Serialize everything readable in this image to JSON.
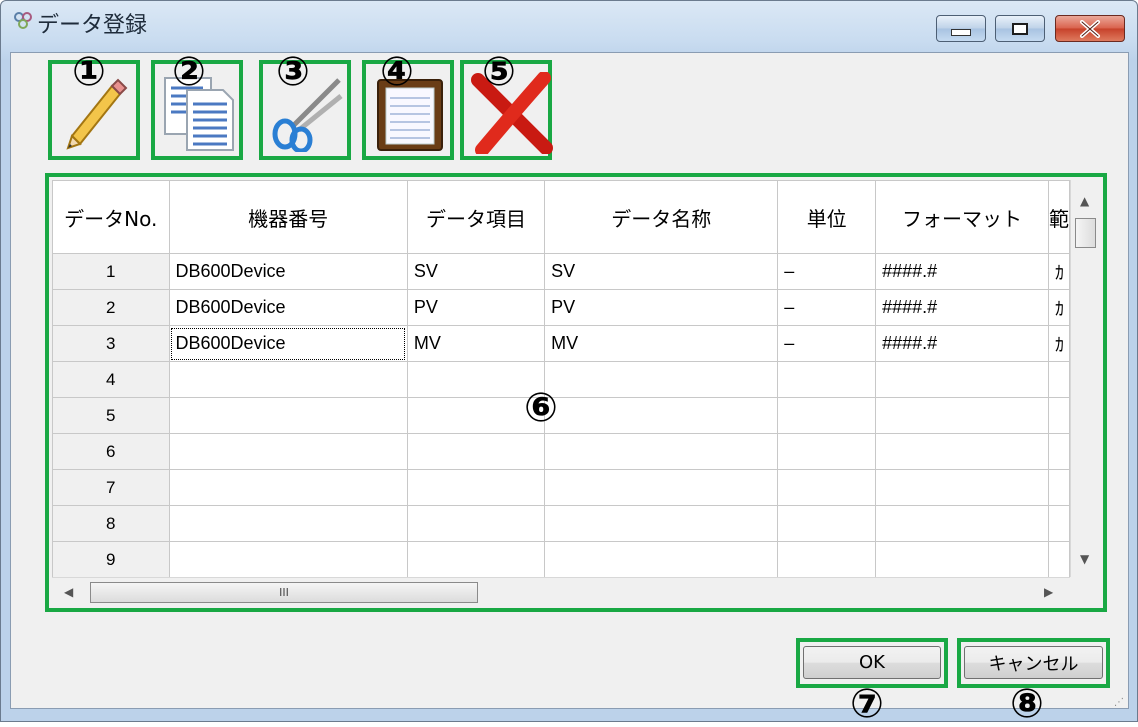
{
  "window": {
    "title": "データ登録"
  },
  "toolbar": {
    "tools": [
      {
        "icon": "pencil-icon",
        "marker": "①"
      },
      {
        "icon": "copy-document-icon",
        "marker": "②"
      },
      {
        "icon": "scissors-icon",
        "marker": "③"
      },
      {
        "icon": "clipboard-icon",
        "marker": "④"
      },
      {
        "icon": "delete-x-icon",
        "marker": "⑤"
      }
    ]
  },
  "grid": {
    "marker": "⑥",
    "columns": [
      "データNo.",
      "機器番号",
      "データ項目",
      "データ名称",
      "単位",
      "フォーマット",
      "範"
    ],
    "rows": [
      {
        "no": "1",
        "device": "DB600Device",
        "item": "SV",
        "name": "SV",
        "unit": "–",
        "format": "####.#",
        "extra": "ｶ"
      },
      {
        "no": "2",
        "device": "DB600Device",
        "item": "PV",
        "name": "PV",
        "unit": "–",
        "format": "####.#",
        "extra": "ｶ"
      },
      {
        "no": "3",
        "device": "DB600Device",
        "item": "MV",
        "name": "MV",
        "unit": "–",
        "format": "####.#",
        "extra": "ｶ"
      },
      {
        "no": "4",
        "device": "",
        "item": "",
        "name": "",
        "unit": "",
        "format": "",
        "extra": ""
      },
      {
        "no": "5",
        "device": "",
        "item": "",
        "name": "",
        "unit": "",
        "format": "",
        "extra": ""
      },
      {
        "no": "6",
        "device": "",
        "item": "",
        "name": "",
        "unit": "",
        "format": "",
        "extra": ""
      },
      {
        "no": "7",
        "device": "",
        "item": "",
        "name": "",
        "unit": "",
        "format": "",
        "extra": ""
      },
      {
        "no": "8",
        "device": "",
        "item": "",
        "name": "",
        "unit": "",
        "format": "",
        "extra": ""
      },
      {
        "no": "9",
        "device": "",
        "item": "",
        "name": "",
        "unit": "",
        "format": "",
        "extra": ""
      }
    ],
    "hscroll_thumb_label": "III"
  },
  "buttons": {
    "ok_label": "OK",
    "ok_marker": "⑦",
    "cancel_label": "キャンセル",
    "cancel_marker": "⑧"
  },
  "colors": {
    "highlight": "#19a844",
    "close_button": "#c7412a"
  }
}
